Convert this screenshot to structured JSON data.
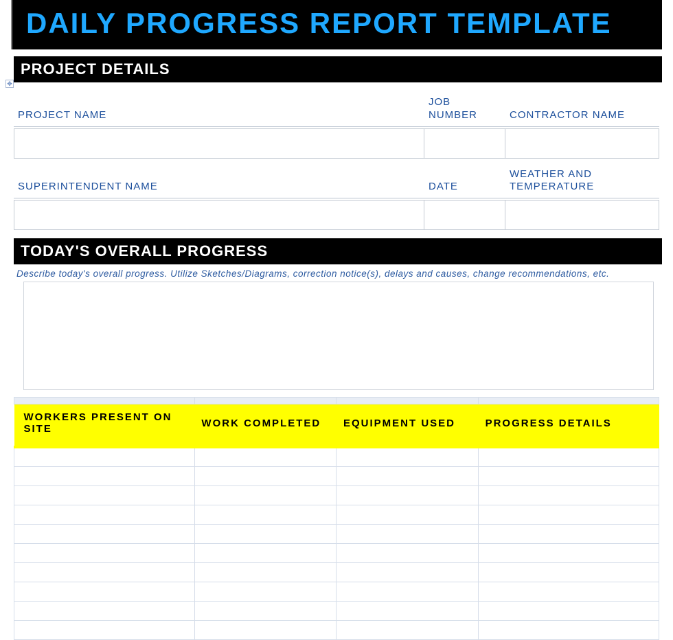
{
  "title": "DAILY PROGRESS REPORT TEMPLATE",
  "sections": {
    "project_details": {
      "heading": "PROJECT DETAILS",
      "fields": {
        "project_name": "PROJECT NAME",
        "job_number": "JOB NUMBER",
        "contractor_name": "CONTRACTOR NAME",
        "superintendent_name": "SUPERINTENDENT NAME",
        "date": "DATE",
        "weather_temp": "WEATHER AND TEMPERATURE"
      },
      "values": {
        "project_name": "",
        "job_number": "",
        "contractor_name": "",
        "superintendent_name": "",
        "date": "",
        "weather_temp": ""
      }
    },
    "overall_progress": {
      "heading": "TODAY'S OVERALL PROGRESS",
      "description": "Describe today's overall progress. Utilize Sketches/Diagrams, correction notice(s), delays and causes, change recommendations, etc.",
      "value": ""
    },
    "summary_table": {
      "columns": {
        "workers": "WORKERS PRESENT ON SITE",
        "completed": "WORK COMPLETED",
        "equipment": "EQUIPMENT USED",
        "progress": "PROGRESS DETAILS"
      },
      "rows": [
        {
          "workers": "",
          "completed": "",
          "equipment": "",
          "progress": ""
        },
        {
          "workers": "",
          "completed": "",
          "equipment": "",
          "progress": ""
        },
        {
          "workers": "",
          "completed": "",
          "equipment": "",
          "progress": ""
        },
        {
          "workers": "",
          "completed": "",
          "equipment": "",
          "progress": ""
        },
        {
          "workers": "",
          "completed": "",
          "equipment": "",
          "progress": ""
        },
        {
          "workers": "",
          "completed": "",
          "equipment": "",
          "progress": ""
        },
        {
          "workers": "",
          "completed": "",
          "equipment": "",
          "progress": ""
        },
        {
          "workers": "",
          "completed": "",
          "equipment": "",
          "progress": ""
        },
        {
          "workers": "",
          "completed": "",
          "equipment": "",
          "progress": ""
        },
        {
          "workers": "",
          "completed": "",
          "equipment": "",
          "progress": ""
        }
      ]
    }
  }
}
